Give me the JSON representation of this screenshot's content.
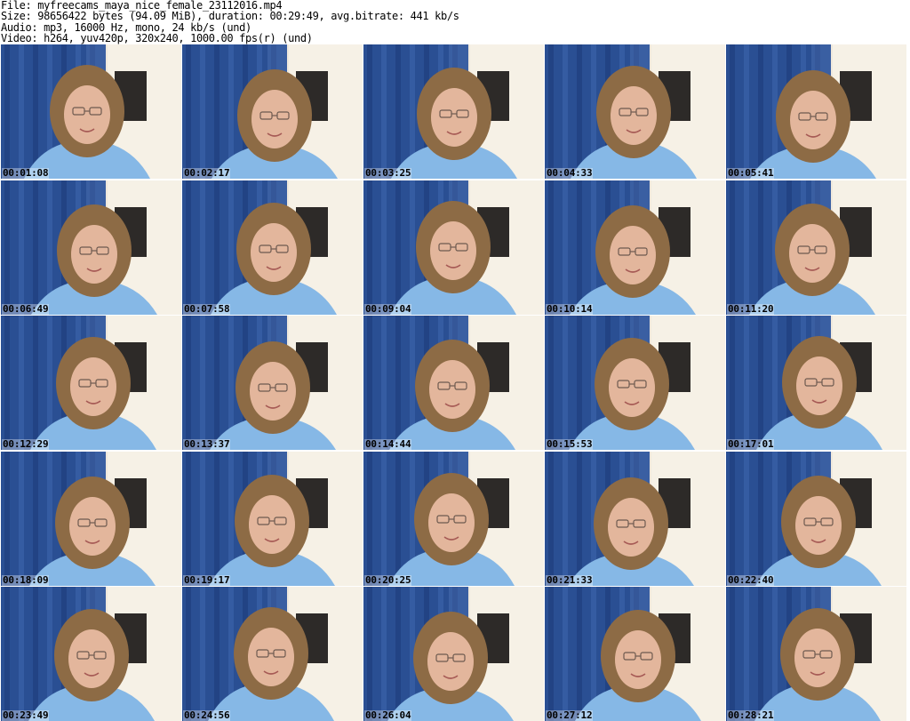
{
  "header": {
    "file_line": "File: myfreecams_maya_nice_female_23112016.mp4",
    "size_line": "Size: 98656422 bytes (94.09 MiB), duration: 00:29:49, avg.bitrate: 441 kb/s",
    "audio_line": "Audio: mp3, 16000 Hz, mono, 24 kb/s (und)",
    "video_line": "Video: h264, yuv420p, 320x240, 1000.00 fps(r) (und)"
  },
  "thumbnails": [
    {
      "timestamp": "00:01:08"
    },
    {
      "timestamp": "00:02:17"
    },
    {
      "timestamp": "00:03:25"
    },
    {
      "timestamp": "00:04:33"
    },
    {
      "timestamp": "00:05:41"
    },
    {
      "timestamp": "00:06:49"
    },
    {
      "timestamp": "00:07:58"
    },
    {
      "timestamp": "00:09:04"
    },
    {
      "timestamp": "00:10:14"
    },
    {
      "timestamp": "00:11:20"
    },
    {
      "timestamp": "00:12:29"
    },
    {
      "timestamp": "00:13:37"
    },
    {
      "timestamp": "00:14:44"
    },
    {
      "timestamp": "00:15:53"
    },
    {
      "timestamp": "00:17:01"
    },
    {
      "timestamp": "00:18:09"
    },
    {
      "timestamp": "00:19:17"
    },
    {
      "timestamp": "00:20:25"
    },
    {
      "timestamp": "00:21:33"
    },
    {
      "timestamp": "00:22:40"
    },
    {
      "timestamp": "00:23:49"
    },
    {
      "timestamp": "00:24:56"
    },
    {
      "timestamp": "00:26:04"
    },
    {
      "timestamp": "00:27:12"
    },
    {
      "timestamp": "00:28:21"
    }
  ],
  "colors": {
    "curtain_blue": "#2a4f93",
    "wall": "#efe8dc",
    "shirt_blue": "#86b8e6",
    "hair": "#8d6b45",
    "skin": "#e3b69c",
    "monitor": "#2d2a28"
  }
}
